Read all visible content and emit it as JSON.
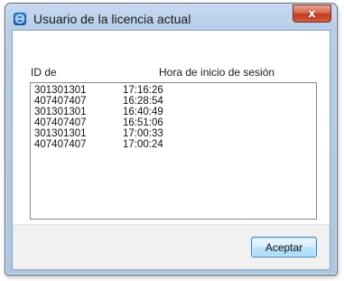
{
  "window": {
    "title": "Usuario de la licencia actual",
    "close_glyph": "x"
  },
  "columns": {
    "id_header": "ID de",
    "time_header": "Hora de inicio de sesión"
  },
  "rows": [
    {
      "id": "301301301",
      "time": "17:16:26"
    },
    {
      "id": "407407407",
      "time": "16:28:54"
    },
    {
      "id": "301301301",
      "time": "16:40:49"
    },
    {
      "id": "407407407",
      "time": "16:51:06"
    },
    {
      "id": "301301301",
      "time": "17:00:33"
    },
    {
      "id": "407407407",
      "time": "17:00:24"
    }
  ],
  "buttons": {
    "accept_label": "Aceptar"
  },
  "icons": {
    "app": "teamviewer-icon",
    "close": "close-icon"
  },
  "colors": {
    "title_bar": "#b7cde8",
    "close_button": "#c4381f",
    "button_border": "#3c7fb1"
  }
}
